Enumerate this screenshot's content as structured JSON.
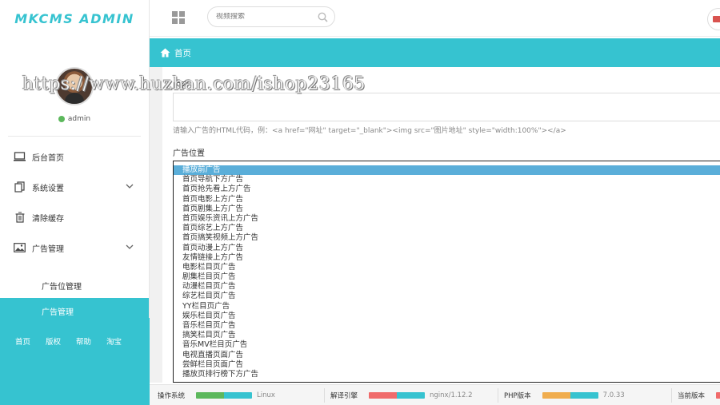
{
  "app": {
    "brand": "MKCMS ADMIN"
  },
  "user": {
    "name": "admin",
    "status_color": "#5cb85c"
  },
  "colors": {
    "accent": "#36c3d0",
    "selected_option": "#5aaed9"
  },
  "sidebar": {
    "items": [
      {
        "label": "后台首页",
        "icon": "monitor-icon"
      },
      {
        "label": "系统设置",
        "icon": "copy-icon",
        "expandable": true
      },
      {
        "label": "清除缓存",
        "icon": "trash-icon"
      },
      {
        "label": "广告管理",
        "icon": "image-icon",
        "expandable": true
      }
    ],
    "submenu": [
      {
        "label": "广告位管理",
        "active": false
      },
      {
        "label": "广告管理",
        "active": true
      }
    ],
    "footer_links": [
      "首页",
      "版权",
      "帮助",
      "淘宝"
    ]
  },
  "topbar": {
    "search_placeholder": "视频搜索"
  },
  "breadcrumb": {
    "label": "首页",
    "icon": "home-icon"
  },
  "form": {
    "content_label": "内容",
    "content_value": "",
    "help_text": "请输入广告的HTML代码，例：<a href=\"网址\" target=\"_blank\"><img src=\"图片地址\" style=\"width:100%\"></a>",
    "position_label": "广告位置",
    "options": [
      "播放前广告",
      "首页导航下方广告",
      "首页抢先看上方广告",
      "首页电影上方广告",
      "首页剧集上方广告",
      "首页娱乐资讯上方广告",
      "首页综艺上方广告",
      "首页搞笑视频上方广告",
      "首页动漫上方广告",
      "友情链接上方广告",
      "电影栏目页广告",
      "剧集栏目页广告",
      "动漫栏目页广告",
      "综艺栏目页广告",
      "YY栏目页广告",
      "娱乐栏目页广告",
      "音乐栏目页广告",
      "搞笑栏目页广告",
      "音乐MV栏目页广告",
      "电视直播页面广告",
      "尝鲜栏目页面广告",
      "播放页排行榜下方广告"
    ],
    "selected_index": 0
  },
  "watermark": "https://www.huzhan.com/ishop23165",
  "status": [
    {
      "label": "操作系统",
      "value": "Linux",
      "colors": [
        "#5cb85c",
        "#36c3d0"
      ]
    },
    {
      "label": "解译引擎",
      "value": "nginx/1.12.2",
      "colors": [
        "#f06b6b",
        "#36c3d0"
      ]
    },
    {
      "label": "PHP版本",
      "value": "7.0.33",
      "colors": [
        "#f0ad4e",
        "#36c3d0"
      ]
    },
    {
      "label": "当前版本",
      "value": "",
      "colors": [
        "#f06b6b",
        "#36c3d0"
      ]
    }
  ]
}
